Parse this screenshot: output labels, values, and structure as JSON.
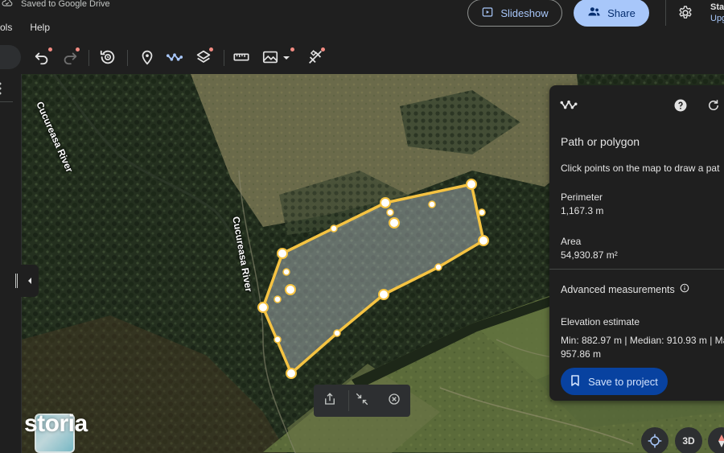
{
  "header": {
    "saved_status": "Saved to Google Drive",
    "menu": [
      "ols",
      "Help"
    ],
    "slideshow_label": "Slideshow",
    "share_label": "Share",
    "account_line1": "Sta",
    "account_line2": "Upg"
  },
  "toolbar": {
    "icons": [
      "undo-icon",
      "redo-icon",
      "historical-imagery-icon",
      "add-placemark-icon",
      "draw-line-icon",
      "layers-icon",
      "measure-icon",
      "add-overlay-icon",
      "clear-tools-icon"
    ]
  },
  "map": {
    "labels": [
      "Cucureasa River",
      "Cucureasa River"
    ],
    "polygon_color": "#f5c342"
  },
  "bottom_tools": {
    "icons": [
      "share-icon",
      "exit-fullscreen-icon",
      "close-circle-icon"
    ]
  },
  "brand": {
    "logo_text": "storia"
  },
  "map_controls": {
    "view_3d_label": "3D"
  },
  "panel": {
    "title": "Path or polygon",
    "instruction": "Click points on the map to draw a pat",
    "perimeter_label": "Perimeter",
    "perimeter_value": "1,167.3 m",
    "area_label": "Area",
    "area_value": "54,930.87 m²",
    "advanced_label": "Advanced measurements",
    "elevation_label": "Elevation estimate",
    "elevation_line1": "Min: 882.97 m | Median: 910.93 m | Ma",
    "elevation_line2": "957.86 m",
    "save_label": "Save to project"
  },
  "colors": {
    "accent": "#a8c7fa",
    "save_button": "#0842a0",
    "polygon_outline": "#f5c342"
  }
}
